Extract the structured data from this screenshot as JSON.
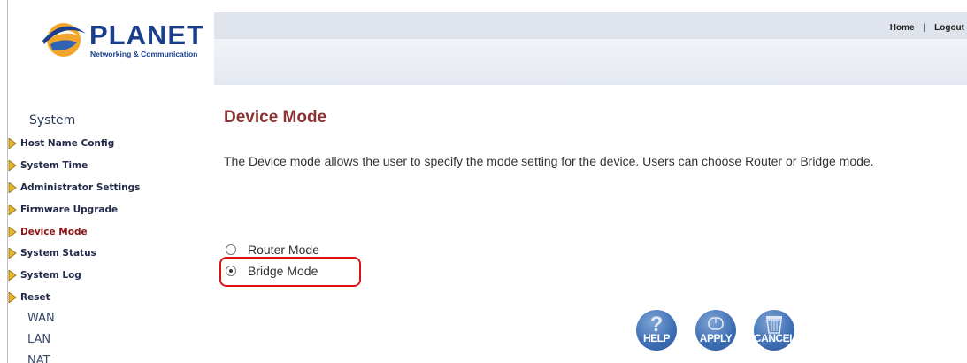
{
  "brand": {
    "name": "PLANET",
    "tagline": "Networking & Communication"
  },
  "header": {
    "home_label": "Home",
    "separator": "|",
    "logout_label": "Logout"
  },
  "sidebar": {
    "section_title": "System",
    "items": [
      {
        "label": "Host Name Config",
        "active": false
      },
      {
        "label": "System Time",
        "active": false
      },
      {
        "label": "Administrator Settings",
        "active": false
      },
      {
        "label": "Firmware Upgrade",
        "active": false
      },
      {
        "label": "Device Mode",
        "active": true
      },
      {
        "label": "System Status",
        "active": false
      },
      {
        "label": "System Log",
        "active": false
      },
      {
        "label": "Reset",
        "active": false
      }
    ],
    "groups": [
      "WAN",
      "LAN",
      "NAT"
    ]
  },
  "main": {
    "title": "Device Mode",
    "description": "The Device mode allows the user to specify the mode setting for the device. Users can choose Router or Bridge mode.",
    "options": [
      {
        "label": "Router Mode",
        "checked": false
      },
      {
        "label": "Bridge Mode",
        "checked": true
      }
    ],
    "buttons": {
      "help": "HELP",
      "apply": "APPLY",
      "cancel": "CANCEL"
    }
  },
  "colors": {
    "accent_title": "#8b3333",
    "active_menu": "#8b1414",
    "highlight": "#e01010",
    "brand_blue": "#1b3f8c",
    "header_bar": "#dfe3eb",
    "button_blue": "#3d6eb5"
  },
  "icons": {
    "menu_arrow": "triangle-right-icon",
    "help": "question-icon",
    "apply": "mouse-icon",
    "cancel": "trash-can-icon"
  }
}
